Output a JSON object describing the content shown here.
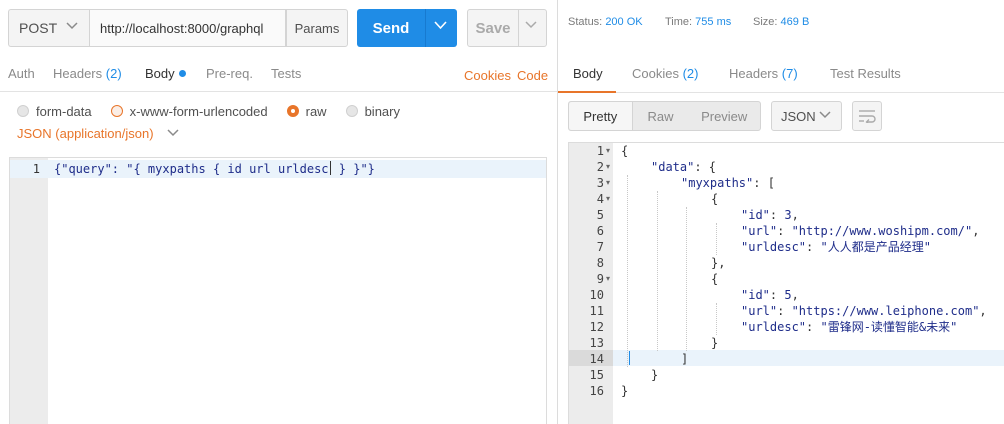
{
  "request": {
    "method": "POST",
    "url": "http://localhost:8000/graphql",
    "params_label": "Params",
    "send_label": "Send",
    "save_label": "Save",
    "tabs": [
      {
        "label": "Auth",
        "count": ""
      },
      {
        "label": "Headers",
        "count": "(2)"
      },
      {
        "label": "Body",
        "count": ""
      },
      {
        "label": "Pre-req.",
        "count": ""
      },
      {
        "label": "Tests",
        "count": ""
      }
    ],
    "cookies_label": "Cookies",
    "code_label": "Code",
    "body_types": [
      "form-data",
      "x-www-form-urlencoded",
      "raw",
      "binary"
    ],
    "selected_body_type": "raw",
    "content_type": "JSON (application/json)",
    "editor": {
      "line_number": "1",
      "code_before_caret": "{\"query\": \"{ myxpaths { id url urldesc",
      "code_after_caret": " } }\"}"
    }
  },
  "response": {
    "status_label": "Status:",
    "status_value": "200 OK",
    "time_label": "Time:",
    "time_value": "755 ms",
    "size_label": "Size:",
    "size_value": "469 B",
    "tabs": [
      {
        "label": "Body",
        "count": ""
      },
      {
        "label": "Cookies",
        "count": "(2)"
      },
      {
        "label": "Headers",
        "count": "(7)"
      },
      {
        "label": "Test Results",
        "count": ""
      }
    ],
    "view_modes": [
      "Pretty",
      "Raw",
      "Preview"
    ],
    "format": "JSON",
    "lines": [
      {
        "num": "1",
        "fold": true
      },
      {
        "num": "2",
        "fold": true
      },
      {
        "num": "3",
        "fold": true
      },
      {
        "num": "4",
        "fold": true
      },
      {
        "num": "5",
        "fold": false
      },
      {
        "num": "6",
        "fold": false
      },
      {
        "num": "7",
        "fold": false
      },
      {
        "num": "8",
        "fold": false
      },
      {
        "num": "9",
        "fold": true
      },
      {
        "num": "10",
        "fold": false
      },
      {
        "num": "11",
        "fold": false
      },
      {
        "num": "12",
        "fold": false
      },
      {
        "num": "13",
        "fold": false
      },
      {
        "num": "14",
        "fold": false
      },
      {
        "num": "15",
        "fold": false
      },
      {
        "num": "16",
        "fold": false
      }
    ],
    "json": {
      "open": "{",
      "data_key": "\"data\"",
      "myxpaths_key": "\"myxpaths\"",
      "items": [
        {
          "id_key": "\"id\"",
          "id_val": "3",
          "url_key": "\"url\"",
          "url_val": "\"http://www.woshipm.com/\"",
          "desc_key": "\"urldesc\"",
          "desc_val": "\"人人都是产品经理\""
        },
        {
          "id_key": "\"id\"",
          "id_val": "5",
          "url_key": "\"url\"",
          "url_val": "\"https://www.leiphone.com\"",
          "desc_key": "\"urldesc\"",
          "desc_val": "\"雷锋网-读懂智能&未来\""
        }
      ]
    }
  }
}
